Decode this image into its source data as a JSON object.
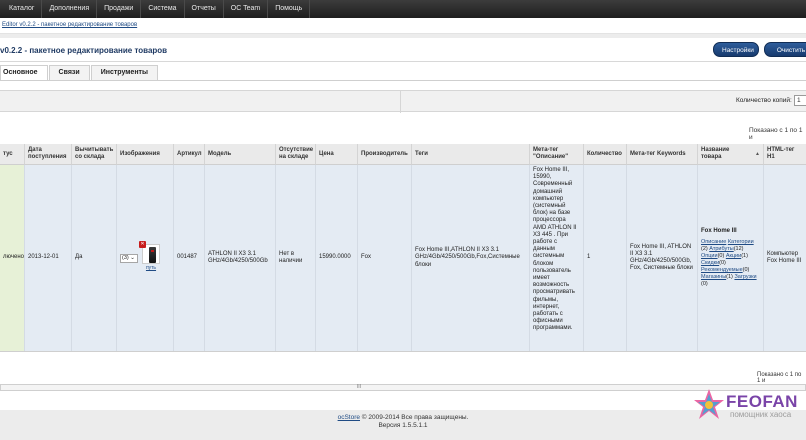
{
  "topnav": {
    "items": [
      "Каталог",
      "Дополнения",
      "Продажи",
      "Система",
      "Отчеты",
      "OC Team",
      "Помощь"
    ]
  },
  "breadcrumb": {
    "text": "Editor v0.2.2 - пакетное редактирование товаров"
  },
  "page": {
    "title": "v0.2.2 - пакетное редактирование товаров",
    "settings_label": "Настройки",
    "clear_label": "Очистить кэш"
  },
  "tabs": [
    "Основное",
    "Связи",
    "Инструменты"
  ],
  "toolbar": {
    "copies_label": "Количество копий:",
    "copies_value": "1"
  },
  "shown_top": "Показано с 1 по 1 и",
  "columns": {
    "status": "тус",
    "date": "Дата поступления",
    "subtract": "Вычитывать со склада",
    "images": "Изображения",
    "sku": "Артикул",
    "model": "Модель",
    "stock_status": "Отсутствие на складе",
    "price": "Цена",
    "manufacturer": "Производитель",
    "tags": "Теги",
    "meta_description": "Мета-тег \"Описание\"",
    "quantity": "Количество",
    "meta_keywords": "Мета-тег Keywords",
    "name": "Название товара",
    "h1": "HTML-тег H1"
  },
  "row": {
    "status": "лючено",
    "date": "2013-12-01",
    "subtract": "Да",
    "images_count": "(3)",
    "thumb_link": "путь",
    "sku": "001487",
    "model": "ATHLON II X3 3.1 GHz/4Gb/4250/500Gb",
    "stock_status": "Нет в наличии",
    "price": "15990.0000",
    "manufacturer": "Fox",
    "tags": "Fox Home III,ATHLON II X3 3.1 GHz/4Gb/4250/500Gb,Fox,Системные блоки",
    "meta_description": "Fox Home III, 15990, Современный домашний компьютер (системный блок) на базе процессора AMD ATHLON II X3 445 . При работе с данным системным блоком пользователь имеет возможность просматривать фильмы, интернет, работать с офисными программами.",
    "quantity": "1",
    "meta_keywords": "Fox Home III, ATHLON II X3 3.1 GHz/4Gb/4250/500Gb, Fox, Системные блоки",
    "name_title": "Fox Home III",
    "name_links": {
      "description": "Описание",
      "categories": "Категории",
      "categories_count": "(2)",
      "attributes": "Атрибуты",
      "attributes_count": "(12)",
      "options": "Опции",
      "options_count": "(0)",
      "specials": "Акции",
      "specials_count": "(1)",
      "discounts": "Скидки",
      "discounts_count": "(0)",
      "related": "Рекомендуемые",
      "related_count": "(0)",
      "stores": "Магазины",
      "stores_count": "(1)",
      "downloads": "Загрузки",
      "downloads_count": "(0)"
    },
    "h1": "Компьютер Fox Home III"
  },
  "shown_bottom": "Показано с 1 по 1 и",
  "scroll_grip": "III",
  "watermark": {
    "text": "FEOFAN",
    "sub": "помощник хаоса"
  },
  "footer": {
    "link": "ocStore",
    "copyright": " © 2009-2014 Все права защищены.",
    "version": "Версия 1.5.5.1.1"
  },
  "colors": {
    "accent": "#1f3a63",
    "nav_bg": "#2a2a2a",
    "row_bg": "#e4ebf3",
    "status_bg": "#e7f1d7"
  }
}
